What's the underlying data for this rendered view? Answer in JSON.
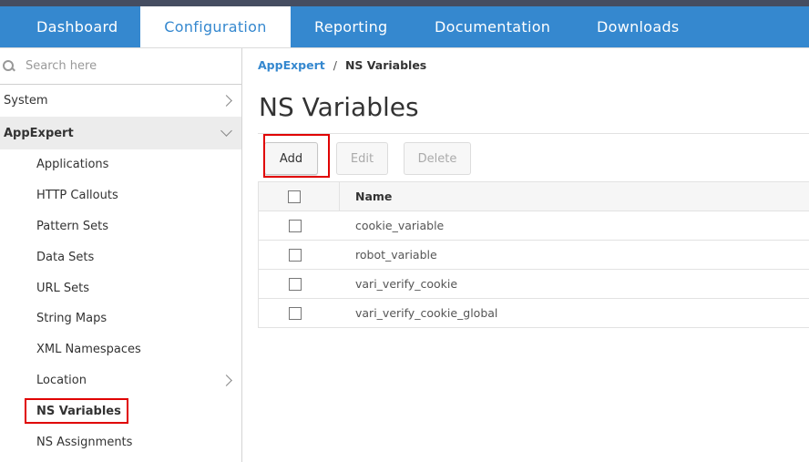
{
  "nav": {
    "tabs": [
      {
        "label": "Dashboard",
        "active": false
      },
      {
        "label": "Configuration",
        "active": true
      },
      {
        "label": "Reporting",
        "active": false
      },
      {
        "label": "Documentation",
        "active": false
      },
      {
        "label": "Downloads",
        "active": false
      }
    ]
  },
  "sidebar": {
    "search_placeholder": "Search here",
    "sections": [
      {
        "label": "System",
        "expanded": false
      },
      {
        "label": "AppExpert",
        "expanded": true
      }
    ],
    "appexpert_items": [
      {
        "label": "Applications"
      },
      {
        "label": "HTTP Callouts"
      },
      {
        "label": "Pattern Sets"
      },
      {
        "label": "Data Sets"
      },
      {
        "label": "URL Sets"
      },
      {
        "label": "String Maps"
      },
      {
        "label": "XML Namespaces"
      },
      {
        "label": "Location",
        "has_children": true
      },
      {
        "label": "NS Variables",
        "active": true
      },
      {
        "label": "NS Assignments"
      }
    ]
  },
  "breadcrumb": {
    "parent": "AppExpert",
    "separator": "/",
    "current": "NS Variables"
  },
  "page": {
    "title": "NS Variables"
  },
  "toolbar": {
    "add_label": "Add",
    "edit_label": "Edit",
    "delete_label": "Delete"
  },
  "table": {
    "columns": [
      "Name"
    ],
    "rows": [
      {
        "name": "cookie_variable"
      },
      {
        "name": "robot_variable"
      },
      {
        "name": "vari_verify_cookie"
      },
      {
        "name": "vari_verify_cookie_global"
      }
    ]
  },
  "colors": {
    "brand": "#3588cf",
    "topstrip": "#454d61",
    "highlight": "#e00000"
  }
}
